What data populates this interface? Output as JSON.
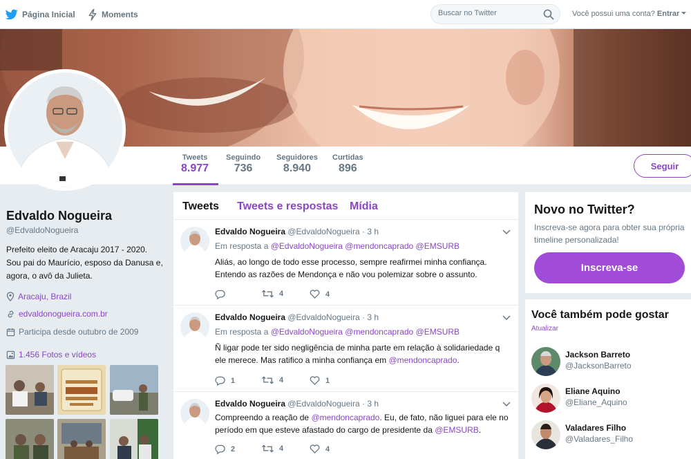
{
  "nav": {
    "home_label": "Página Inicial",
    "moments_label": "Moments",
    "search_placeholder": "Buscar no Twitter",
    "account_question": "Você possui uma conta?",
    "login_label": "Entrar"
  },
  "profile": {
    "name": "Edvaldo Nogueira",
    "handle": "@EdvaldoNogueira",
    "bio": "Prefeito eleito de Aracaju 2017 - 2020. Sou pai do Maurício, esposo da Danusa e, agora, o avô da Julieta.",
    "location": "Aracaju, Brazil",
    "website": "edvaldonogueira.com.br",
    "joined": "Participa desde outubro de 2009",
    "photos_label": "1.456 Fotos e vídeos"
  },
  "stats": [
    {
      "label": "Tweets",
      "value": "8.977"
    },
    {
      "label": "Seguindo",
      "value": "736"
    },
    {
      "label": "Seguidores",
      "value": "8.940"
    },
    {
      "label": "Curtidas",
      "value": "896"
    }
  ],
  "follow_label": "Seguir",
  "timeline": {
    "tabs": [
      "Tweets",
      "Tweets e respostas",
      "Mídia"
    ],
    "tweets": [
      {
        "name": "Edvaldo Nogueira",
        "handle": "@EdvaldoNogueira",
        "time": "3 h",
        "reply_prefix": "Em resposta a",
        "reply_mentions": "@EdvaldoNogueira @mendoncaprado @EMSURB",
        "text": "Aliás, ao longo de todo esse processo, sempre reafirmei minha confiança. Entendo as razões de Mendonça e não vou polemizar sobre o assunto.",
        "replies": "",
        "retweets": "4",
        "likes": "4"
      },
      {
        "name": "Edvaldo Nogueira",
        "handle": "@EdvaldoNogueira",
        "time": "3 h",
        "reply_prefix": "Em resposta a",
        "reply_mentions": "@EdvaldoNogueira @mendoncaprado @EMSURB",
        "text_before": "Ñ ligar pode ter sido negligência de minha parte em relação à solidariedade q ele merece. Mas ratifico a minha confiança em ",
        "text_mention": "@mendoncaprado",
        "text_after": ".",
        "replies": "1",
        "retweets": "4",
        "likes": "1"
      },
      {
        "name": "Edvaldo Nogueira",
        "handle": "@EdvaldoNogueira",
        "time": "3 h",
        "text_before": "Compreendo a reação de ",
        "text_mention": "@mendoncaprado",
        "text_middle": ". Eu, de fato, não liguei para ele no período em que esteve afastado do cargo de presidente da ",
        "text_mention2": "@EMSURB",
        "text_after": ".",
        "replies": "2",
        "retweets": "4",
        "likes": "4"
      }
    ]
  },
  "signup": {
    "title": "Novo no Twitter?",
    "text": "Inscreva-se agora para obter sua própria timeline personalizada!",
    "button": "Inscreva-se"
  },
  "who_to_follow": {
    "title": "Você também pode gostar",
    "refresh": "Atualizar",
    "users": [
      {
        "name": "Jackson Barreto",
        "handle": "@JacksonBarreto"
      },
      {
        "name": "Eliane Aquino",
        "handle": "@Eliane_Aquino"
      },
      {
        "name": "Valadares Filho",
        "handle": "@Valadares_Filho"
      }
    ]
  },
  "colors": {
    "accent": "#8b46c8",
    "signup_button": "#a04cd8",
    "nav_icon": "#1da1f2"
  },
  "icons": [
    "twitter-bird-icon",
    "lightning-icon",
    "search-icon",
    "caret-down-icon",
    "location-pin-icon",
    "link-icon",
    "calendar-icon",
    "photo-icon",
    "chevron-down-icon",
    "reply-icon",
    "retweet-icon",
    "heart-icon"
  ]
}
